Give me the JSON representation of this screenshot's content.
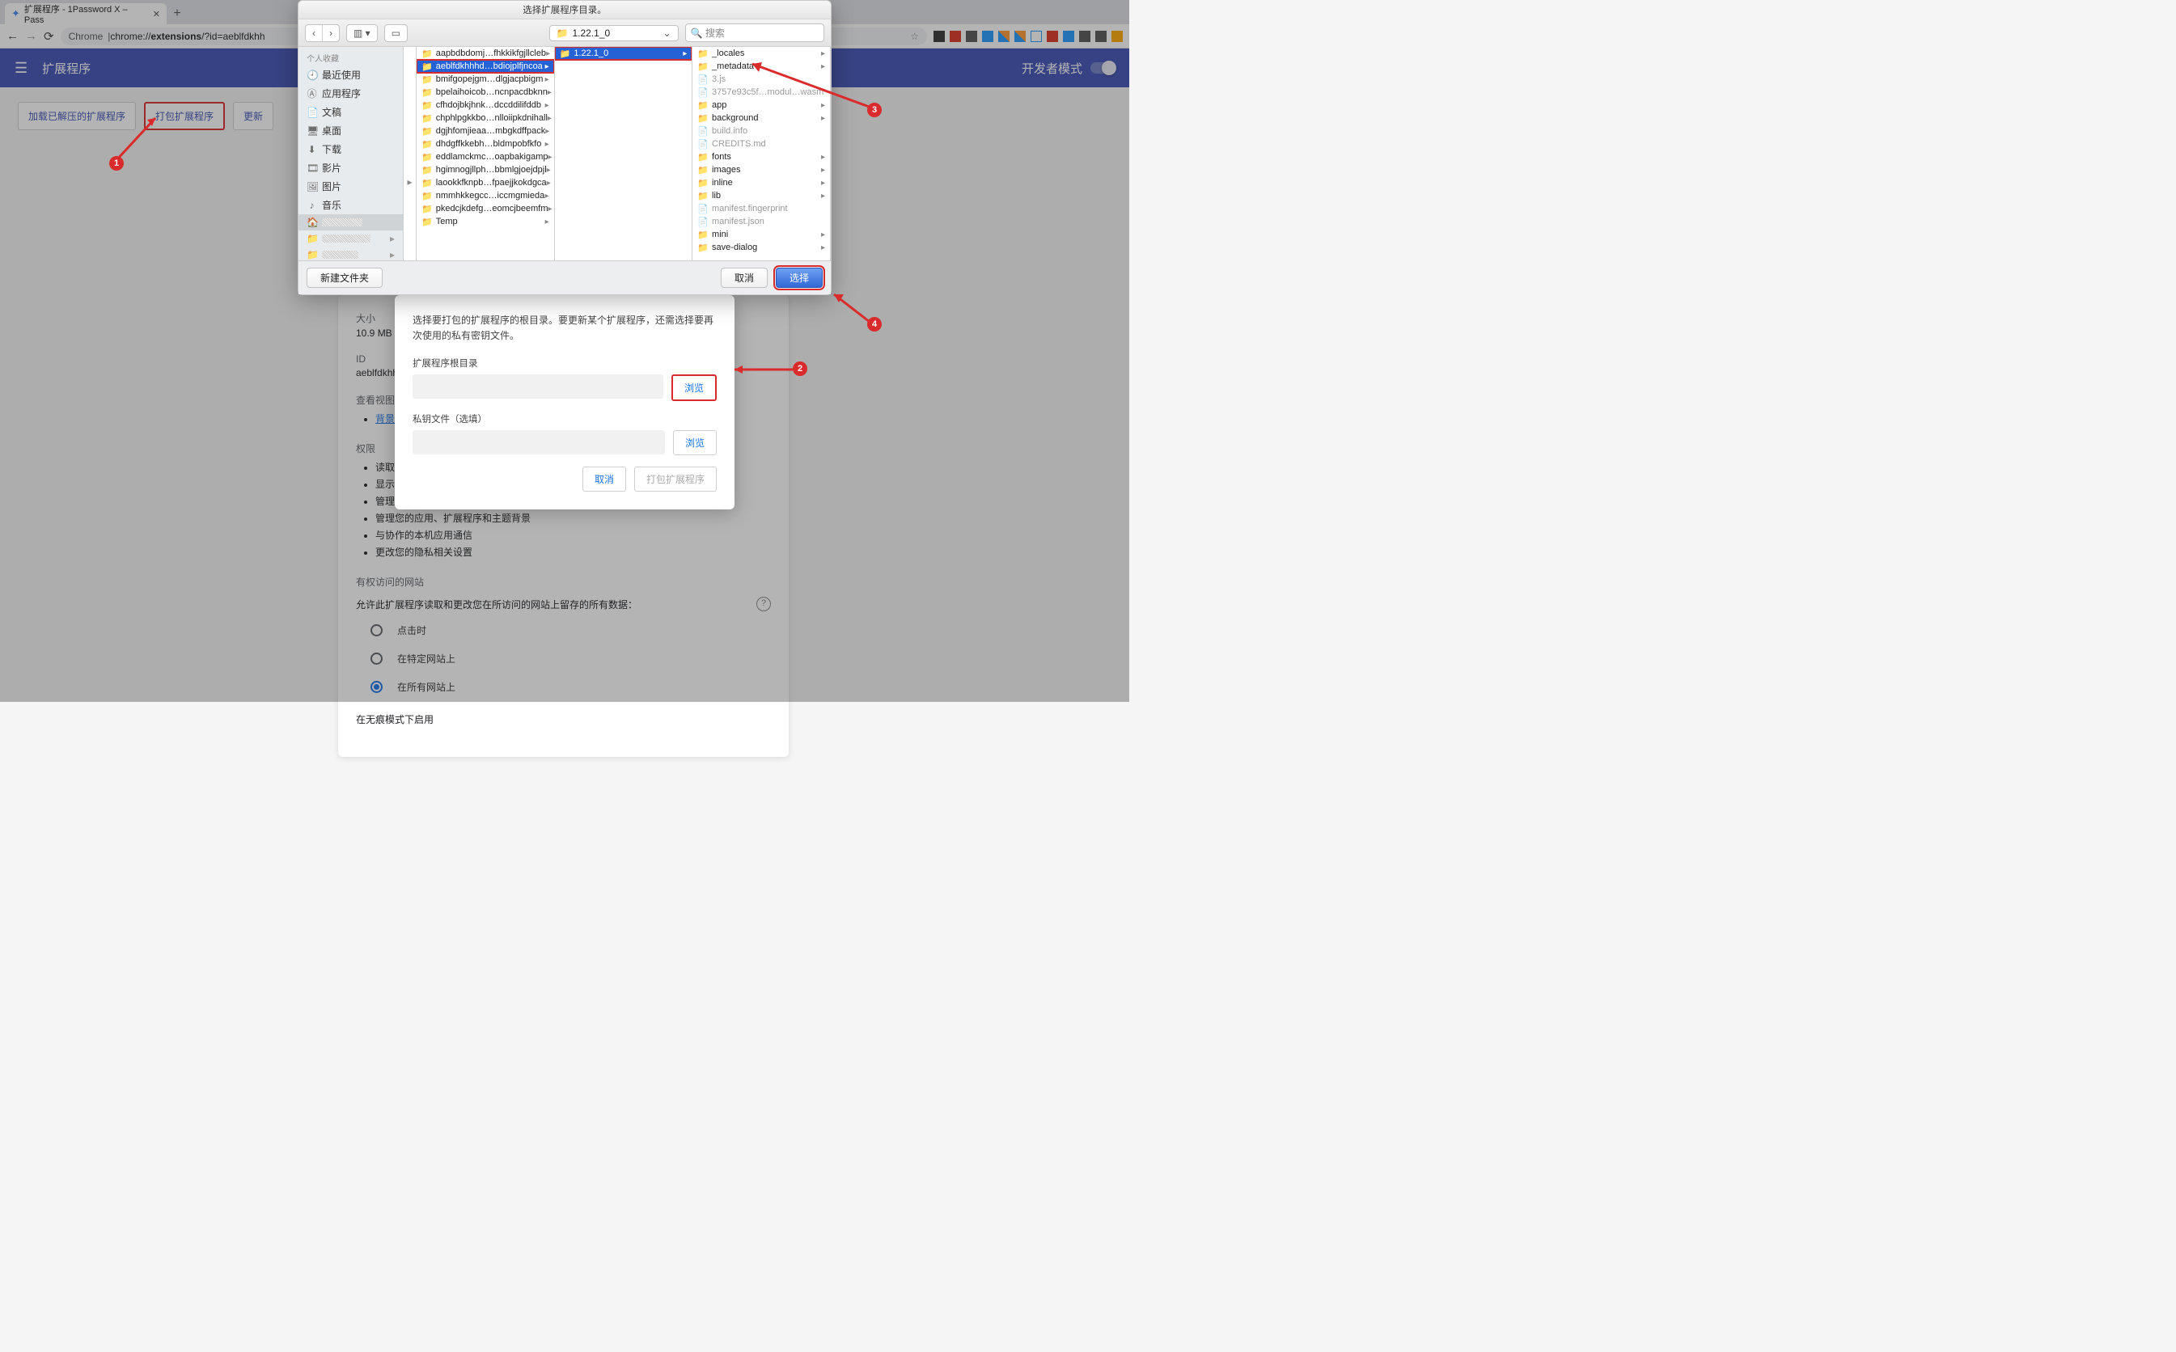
{
  "browser": {
    "tab_title": "扩展程序 - 1Password X – Pass",
    "url_prefix": "Chrome",
    "url": "chrome://extensions/?id=aeblfdkhh",
    "url_bold_part": "extensions"
  },
  "ext_header": {
    "title": "扩展程序",
    "dev_mode": "开发者模式"
  },
  "action_buttons": {
    "load_unpacked": "加载已解压的扩展程序",
    "pack": "打包扩展程序",
    "update": "更新"
  },
  "detail": {
    "size_label": "大小",
    "size_value": "10.9 MB",
    "id_label": "ID",
    "id_value": "aeblfdkhhh",
    "view_label": "查看视图",
    "bg_page": "背景页",
    "perm_label": "权限",
    "perms": [
      "读取您的",
      "显示通",
      "管理您的下载内容",
      "管理您的应用、扩展程序和主题背景",
      "与协作的本机应用通信",
      "更改您的隐私相关设置"
    ],
    "site_access": {
      "header": "有权访问的网站",
      "desc": "允许此扩展程序读取和更改您在所访问的网站上留存的所有数据：",
      "opt1": "点击时",
      "opt2": "在特定网站上",
      "opt3": "在所有网站上"
    },
    "incognito_header": "在无痕模式下启用"
  },
  "pack_dialog": {
    "desc": "选择要打包的扩展程序的根目录。要更新某个扩展程序，还需选择要再次使用的私有密钥文件。",
    "root_label": "扩展程序根目录",
    "key_label": "私钥文件（选填）",
    "browse": "浏览",
    "cancel": "取消",
    "pack": "打包扩展程序"
  },
  "finder": {
    "title": "选择扩展程序目录。",
    "path_current": "1.22.1_0",
    "search_placeholder": "搜索",
    "sidebar_header": "个人收藏",
    "sidebar": [
      {
        "icon": "⌚",
        "label": "最近使用"
      },
      {
        "icon": "Ⓐ",
        "label": "应用程序"
      },
      {
        "icon": "📄",
        "label": "文稿"
      },
      {
        "icon": "🖥",
        "label": "桌面"
      },
      {
        "icon": "⬇",
        "label": "下载"
      },
      {
        "icon": "🎞",
        "label": "影片"
      },
      {
        "icon": "🖼",
        "label": "图片"
      },
      {
        "icon": "♪",
        "label": "音乐"
      },
      {
        "icon": "🏠",
        "label": "(home)"
      }
    ],
    "sidebar_folders": [
      "—",
      "—",
      "—"
    ],
    "col1": [
      "aapbdbdomj…fhkkikfgjllcleb",
      "aeblfdkhhhd…bdiojplfjncoa",
      "bmifgopejgm…dlgjacpbigm",
      "bpelaihoicob…ncnpacdbknn",
      "cfhdojbkjhnk…dccddilifddb",
      "chphlpgkkbo…nlloiipkdnihall",
      "dgjhfomjieaa…mbgkdffpack",
      "dhdgffkkebh…bldmpobfkfo",
      "eddlamckmc…oapbakigamp",
      "hgimnogjllph…bbmlgjoejdpjl",
      "laookkfknpb…fpaejjkokdgca",
      "nmmhkkegcc…iccmgmieda",
      "pkedcjkdefg…eomcjbeemfm",
      "Temp"
    ],
    "col1_selected_index": 1,
    "col2": [
      "1.22.1_0"
    ],
    "col3_folders": [
      "_locales",
      "_metadata",
      "app",
      "background",
      "fonts",
      "images",
      "inline",
      "lib",
      "mini",
      "save-dialog"
    ],
    "col3_files": [
      {
        "name": "3.js",
        "pos": 2
      },
      {
        "name": "3757e93c5f…modul…wasm",
        "pos": 3
      },
      {
        "name": "build.info",
        "pos": 6
      },
      {
        "name": "CREDITS.md",
        "pos": 7
      },
      {
        "name": "manifest.fingerprint",
        "pos": 12
      },
      {
        "name": "manifest.json",
        "pos": 13
      }
    ],
    "new_folder": "新建文件夹",
    "cancel": "取消",
    "select": "选择"
  },
  "annotations": {
    "1": "1",
    "2": "2",
    "3": "3",
    "4": "4"
  }
}
